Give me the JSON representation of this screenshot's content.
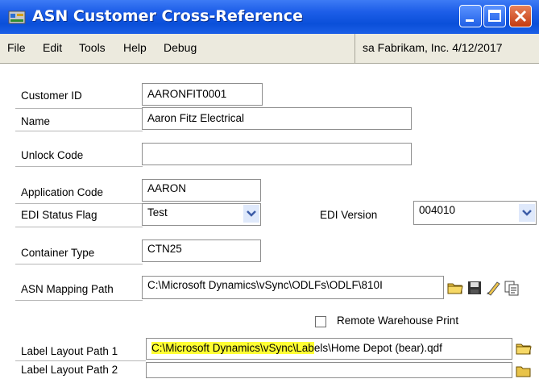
{
  "window": {
    "title": "ASN Customer Cross-Reference"
  },
  "menu": {
    "file": "File",
    "edit": "Edit",
    "tools": "Tools",
    "help": "Help",
    "debug": "Debug"
  },
  "sysinfo": "sa  Fabrikam, Inc.  4/12/2017",
  "form": {
    "customer_id_label": "Customer ID",
    "customer_id": "AARONFIT0001",
    "name_label": "Name",
    "name": "Aaron Fitz Electrical",
    "unlock_code_label": "Unlock Code",
    "unlock_code": "",
    "application_code_label": "Application Code",
    "application_code": "AARON",
    "edi_status_flag_label": "EDI Status Flag",
    "edi_status_flag": "Test",
    "edi_version_label": "EDI Version",
    "edi_version": "004010",
    "container_type_label": "Container Type",
    "container_type": "CTN25",
    "asn_mapping_path_label": "ASN Mapping Path",
    "asn_mapping_path": "C:\\Microsoft Dynamics\\vSync\\ODLFs\\ODLF\\810I",
    "remote_warehouse_label": "Remote Warehouse Print",
    "label_layout_path1_label": "Label Layout Path 1",
    "label_layout_path1_highlight": "C:\\Microsoft Dynamics\\vSync\\Lab",
    "label_layout_path1_rest": "els\\Home Depot (bear).qdf",
    "label_layout_path2_label": "Label Layout Path 2"
  }
}
